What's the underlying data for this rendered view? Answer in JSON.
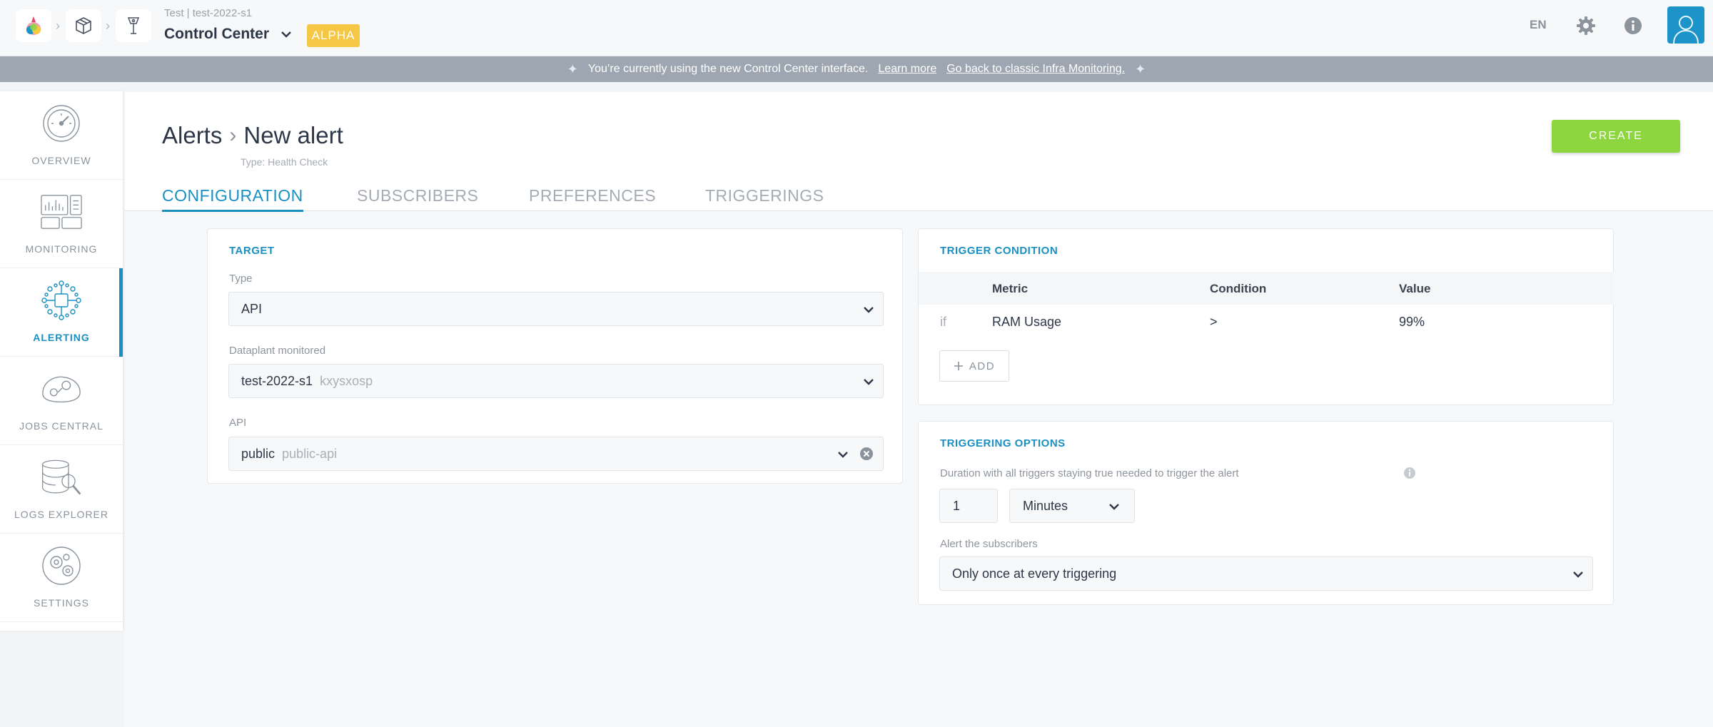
{
  "header": {
    "project_small": "Test | test-2022-s1",
    "project_title": "Control Center",
    "badge": "ALPHA",
    "language": "EN"
  },
  "banner": {
    "text": "You’re currently using the new Control Center interface.",
    "learn_more": "Learn more",
    "go_back": "Go back to classic Infra Monitoring."
  },
  "sidebar": {
    "items": [
      {
        "label": "OVERVIEW",
        "icon": "gauge-icon"
      },
      {
        "label": "MONITORING",
        "icon": "dashboard-icon"
      },
      {
        "label": "ALERTING",
        "icon": "alerting-network-icon"
      },
      {
        "label": "JOBS CENTRAL",
        "icon": "jobs-icon"
      },
      {
        "label": "LOGS EXPLORER",
        "icon": "logs-search-icon"
      },
      {
        "label": "SETTINGS",
        "icon": "settings-gears-icon"
      }
    ],
    "active_index": 2
  },
  "page": {
    "breadcrumb_root": "Alerts",
    "breadcrumb_current": "New alert",
    "subtitle": "Type: Health Check",
    "create_label": "CREATE",
    "tabs": [
      "CONFIGURATION",
      "SUBSCRIBERS",
      "PREFERENCES",
      "TRIGGERINGS"
    ],
    "active_tab": 0
  },
  "target": {
    "title": "TARGET",
    "type_label": "Type",
    "type_value": "API",
    "dataplant_label": "Dataplant monitored",
    "dataplant_value": "test-2022-s1",
    "dataplant_id": "kxysxosp",
    "api_label": "API",
    "api_value": "public",
    "api_id": "public-api"
  },
  "trigger_condition": {
    "title": "TRIGGER CONDITION",
    "columns": [
      "Metric",
      "Condition",
      "Value"
    ],
    "rows": [
      {
        "prefix": "if",
        "metric": "RAM Usage",
        "condition": ">",
        "value": "99%"
      }
    ],
    "add_label": "ADD"
  },
  "triggering_options": {
    "title": "TRIGGERING OPTIONS",
    "duration_label": "Duration with all triggers staying true needed to trigger the alert",
    "duration_value": "1",
    "duration_unit": "Minutes",
    "subscribers_label": "Alert the subscribers",
    "subscribers_value": "Only once at every triggering"
  },
  "colors": {
    "accent": "#1a8fc2",
    "create": "#8ed63f",
    "badge": "#f5c744",
    "banner": "#9ea7b1"
  }
}
